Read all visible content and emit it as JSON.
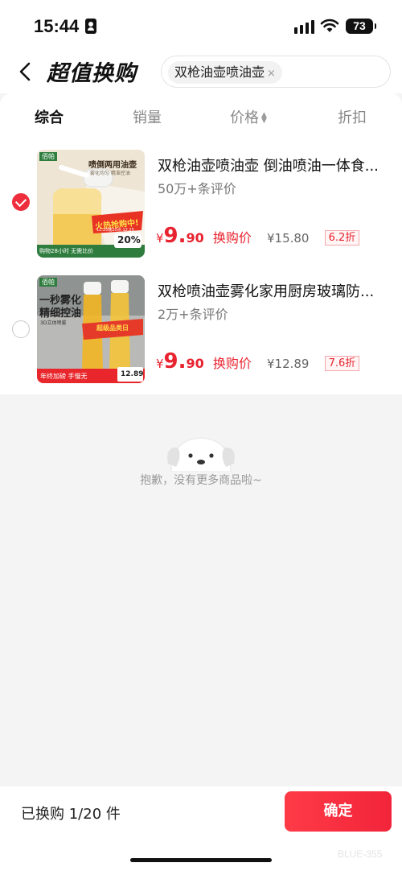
{
  "status_bar": {
    "time": "15:44",
    "battery": "73"
  },
  "header": {
    "title": "超值换购",
    "search_chip": "双枪油壶喷油壶",
    "chip_close": "×"
  },
  "sort_tabs": [
    {
      "label": "综合",
      "active": true
    },
    {
      "label": "销量",
      "active": false
    },
    {
      "label": "价格",
      "active": false
    },
    {
      "label": "折扣",
      "active": false
    }
  ],
  "products": [
    {
      "title": "双枪油壶喷油壶 倒油喷油一体食...",
      "reviews": "50万+条评价",
      "price_symbol": "¥",
      "price_int": "9.",
      "price_dec": "90",
      "price_label": "换购价",
      "original_price": "¥15.80",
      "discount": "6.2折",
      "checked": true,
      "thumb_texts": {
        "brand": "佰帕",
        "headline": "喷倒两用油壶",
        "sub": "雾化均匀 精准控油",
        "promo": "火热抢购中!",
        "promo_date": "12.25晚20点-12.25",
        "bottom_strip": "购物28小时 无需比价",
        "badge": "20%"
      }
    },
    {
      "title": "双枪喷油壶雾化家用厨房玻璃防...",
      "reviews": "2万+条评价",
      "price_symbol": "¥",
      "price_int": "9.",
      "price_dec": "90",
      "price_label": "换购价",
      "original_price": "¥12.89",
      "discount": "7.6折",
      "checked": false,
      "thumb_texts": {
        "brand": "佰帕",
        "headline1": "一秒雾化",
        "headline2": "精细控油",
        "sub": "3D立体喷雾",
        "promo": "超级品类日",
        "bottom_strip": "年终加磅 手慢无",
        "badge_price": "12.89"
      }
    }
  ],
  "empty_state": {
    "text": "抱歉，没有更多商品啦~"
  },
  "footer": {
    "selected_count": "已换购 1/20 件",
    "confirm_label": "确定",
    "watermark": "BLUE-355"
  }
}
